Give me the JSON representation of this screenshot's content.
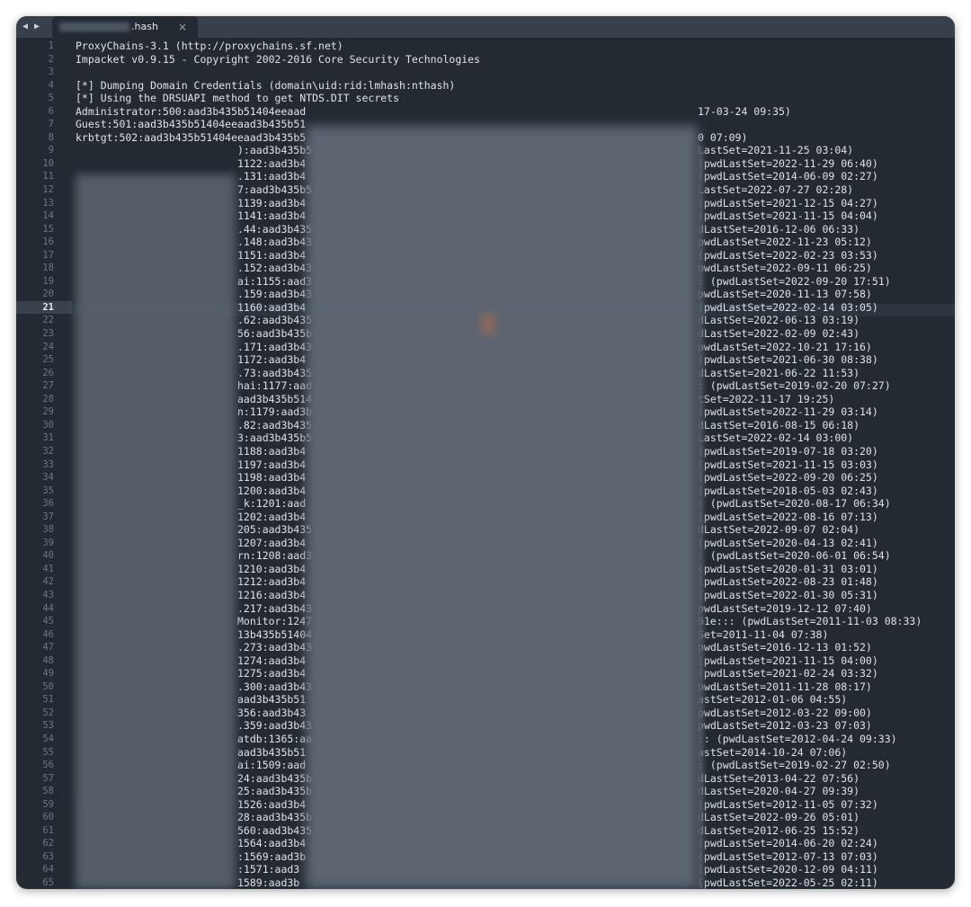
{
  "tab": {
    "back_glyph": "◀",
    "forward_glyph": "▶",
    "name": ".hash",
    "close_glyph": "×"
  },
  "current_line": 21,
  "header_lines": [
    "ProxyChains-3.1 (http://proxychains.sf.net)",
    "Impacket v0.9.15 - Copyright 2002-2016 Core Security Technologies",
    "",
    "[*] Dumping Domain Credentials (domain\\uid:rid:lmhash:nthash)",
    "[*] Using the DRSUAPI method to get NTDS.DIT secrets",
    "Administrator:500:aad3b435b51404eeaad",
    "Guest:501:aad3b435b51404eeaad3b435b51",
    "krbtgt:502:aad3b435b51404eeaad3b435b5"
  ],
  "header_tails": [
    "",
    "",
    "",
    "",
    "",
    "17-03-24 09:35)",
    "",
    "0 07:09)"
  ],
  "rows": [
    {
      "pre": "):aad3b435b5",
      "post": "LastSet=2021-11-25 03:04)"
    },
    {
      "pre": "1122:aad3b4",
      "post": "(pwdLastSet=2022-11-29 06:40)"
    },
    {
      "pre": ".131:aad3b4",
      "post": "(pwdLastSet=2014-06-09 02:27)"
    },
    {
      "pre": "7:aad3b435b5",
      "post": "LastSet=2022-07-27 02:28)"
    },
    {
      "pre": "1139:aad3b4",
      "post": "(pwdLastSet=2021-12-15 04:27)"
    },
    {
      "pre": "1141:aad3b4",
      "post": "(pwdLastSet=2021-11-15 04:04)"
    },
    {
      "pre": ".44:aad3b435",
      "post": "dLastSet=2016-12-06 06:33)"
    },
    {
      "pre": ".148:aad3b43",
      "post": "pwdLastSet=2022-11-23 05:12)"
    },
    {
      "pre": "1151:aad3b4",
      "post": "(pwdLastSet=2022-02-23 03:53)"
    },
    {
      "pre": ".152:aad3b43",
      "post": "pwdLastSet=2022-09-11 06:25)"
    },
    {
      "pre": "ai:1155:aad3",
      "post": ": (pwdLastSet=2022-09-20 17:51)"
    },
    {
      "pre": ".159:aad3b43",
      "post": "pwdLastSet=2020-11-13 07:58)"
    },
    {
      "pre": "1160:aad3b4",
      "post": "(pwdLastSet=2022-02-14 03:05)"
    },
    {
      "pre": ".62:aad3b435",
      "post": "dLastSet=2022-06-13 03:19)"
    },
    {
      "pre": "56:aad3b435b",
      "post": "dLastSet=2022-02-09 02:43)"
    },
    {
      "pre": ".171:aad3b43",
      "post": "pwdLastSet=2022-10-21 17:16)"
    },
    {
      "pre": "1172:aad3b4",
      "post": "(pwdLastSet=2021-06-30 08:38)"
    },
    {
      "pre": ".73:aad3b435",
      "post": "dLastSet=2021-06-22 11:53)"
    },
    {
      "pre": "hai:1177:aad",
      "post": ": (pwdLastSet=2019-02-20 07:27)"
    },
    {
      "pre": "aad3b435b514",
      "post": "tSet=2022-11-17 19:25)"
    },
    {
      "pre": "n:1179:aad3b",
      "post": "(pwdLastSet=2022-11-29 03:14)"
    },
    {
      "pre": ".82:aad3b435",
      "post": "dLastSet=2016-08-15 06:18)"
    },
    {
      "pre": "3:aad3b435b5",
      "post": "LastSet=2022-02-14 03:00)"
    },
    {
      "pre": "1188:aad3b4",
      "post": "(pwdLastSet=2019-07-18 03:20)"
    },
    {
      "pre": "1197:aad3b4",
      "post": "(pwdLastSet=2021-11-15 03:03)"
    },
    {
      "pre": "1198:aad3b4",
      "post": "(pwdLastSet=2022-09-20 06:25)"
    },
    {
      "pre": "1200:aad3b4",
      "post": "(pwdLastSet=2018-05-03 02:43)"
    },
    {
      "pre": "_k:1201:aad",
      "post": ": (pwdLastSet=2020-08-17 06:34)"
    },
    {
      "pre": "1202:aad3b4",
      "post": "(pwdLastSet=2022-08-16 07:13)"
    },
    {
      "pre": "205:aad3b435",
      "post": "dLastSet=2022-09-07 02:04)"
    },
    {
      "pre": "1207:aad3b4",
      "post": "(pwdLastSet=2020-04-13 02:41)"
    },
    {
      "pre": "rn:1208:aad3",
      "post": ": (pwdLastSet=2020-06-01 06:54)"
    },
    {
      "pre": "1210:aad3b4",
      "post": "(pwdLastSet=2020-01-31 03:01)"
    },
    {
      "pre": "1212:aad3b4",
      "post": "(pwdLastSet=2022-08-23 01:48)"
    },
    {
      "pre": "1216:aad3b4",
      "post": "(pwdLastSet=2022-01-30 05:31)"
    },
    {
      "pre": ".217:aad3b43",
      "post": "pwdLastSet=2019-12-12 07:40)"
    },
    {
      "pre": "Monitor:1247",
      "post": "61e::: (pwdLastSet=2011-11-03 08:33)"
    },
    {
      "pre": "13b435b51404",
      "post": "Set=2011-11-04 07:38)"
    },
    {
      "pre": ".273:aad3b43",
      "post": "pwdLastSet=2016-12-13 01:52)"
    },
    {
      "pre": "1274:aad3b4",
      "post": "(pwdLastSet=2021-11-15 04:00)"
    },
    {
      "pre": "1275:aad3b4",
      "post": "(pwdLastSet=2021-02-24 03:32)"
    },
    {
      "pre": ".300:aad3b43",
      "post": "pwdLastSet=2011-11-28 08:17)"
    },
    {
      "pre": "aad3b435b51",
      "post": "astSet=2012-01-06 04:55)"
    },
    {
      "pre": "356:aad3b43",
      "post": "pwdLastSet=2012-03-22 09:00)"
    },
    {
      "pre": ".359:aad3b43",
      "post": "pwdLastSet=2012-03-23 07:03)"
    },
    {
      "pre": "atdb:1365:aa",
      "post": ":: (pwdLastSet=2012-04-24 09:33)"
    },
    {
      "pre": "aad3b435b51",
      "post": "astSet=2014-10-24 07:06)"
    },
    {
      "pre": "ai:1509:aad",
      "post": ": (pwdLastSet=2019-02-27 02:50)"
    },
    {
      "pre": "24:aad3b435b",
      "post": "dLastSet=2013-04-22 07:56)"
    },
    {
      "pre": "25:aad3b435b",
      "post": "dLastSet=2020-04-27 09:39)"
    },
    {
      "pre": "1526:aad3b4",
      "post": "(pwdLastSet=2012-11-05 07:32)"
    },
    {
      "pre": "28:aad3b435b",
      "post": "dLastSet=2022-09-26 05:01)"
    },
    {
      "pre": "560:aad3b435",
      "post": "dLastSet=2012-06-25 15:52)"
    },
    {
      "pre": "1564:aad3b4",
      "post": "(pwdLastSet=2014-06-20 02:24)"
    },
    {
      "pre": ":1569:aad3b",
      "post": "(pwdLastSet=2012-07-13 07:03)"
    },
    {
      "pre": ":1571:aad3",
      "post": "(pwdLastSet=2020-12-09 04:11)"
    },
    {
      "pre": "1589:aad3b",
      "post": "(pwdLastSet=2022-05-25 02:11)"
    }
  ]
}
